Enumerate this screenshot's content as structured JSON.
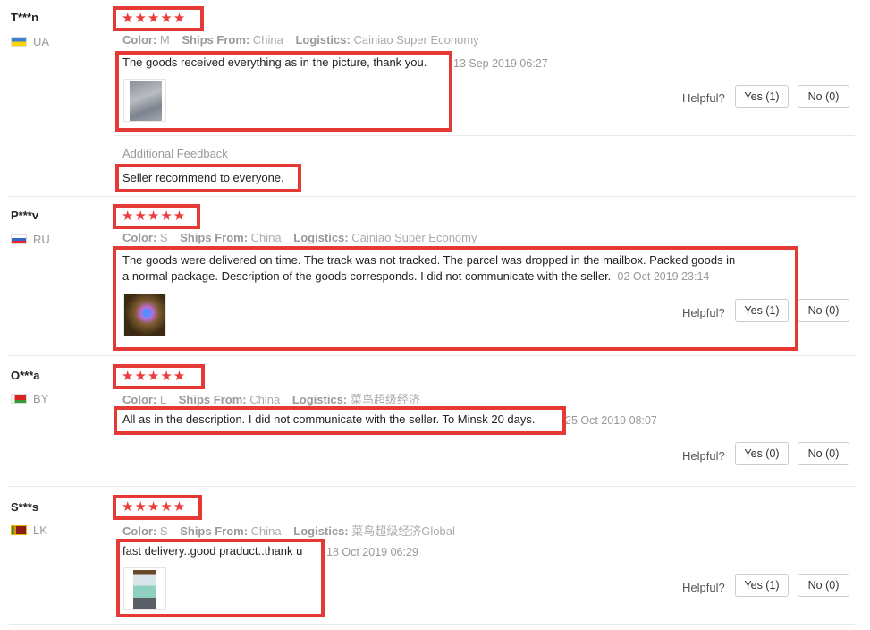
{
  "helpful_label": "Helpful?",
  "reviews": [
    {
      "user": "T***n",
      "country": "UA",
      "stars": "★★★★★",
      "color_label": "Color:",
      "color": "M",
      "ships_label": "Ships From:",
      "ships": "China",
      "logistics_label": "Logistics:",
      "logistics": "Cainiao Super Economy",
      "text": "The goods received everything as in the picture, thank you.",
      "date": "13 Sep 2019 06:27",
      "yes": "Yes (1)",
      "no": "No (0)",
      "additional_label": "Additional Feedback",
      "additional_text": "Seller recommend to everyone."
    },
    {
      "user": "P***v",
      "country": "RU",
      "stars": "★★★★★",
      "color_label": "Color:",
      "color": "S",
      "ships_label": "Ships From:",
      "ships": "China",
      "logistics_label": "Logistics:",
      "logistics": "Cainiao Super Economy",
      "text_line1": "The goods were delivered on time. The track was not tracked. The parcel was dropped in the mailbox. Packed goods in",
      "text_line2": "a normal package. Description of the goods corresponds. I did not communicate with the seller.",
      "date": "02 Oct 2019 23:14",
      "yes": "Yes (1)",
      "no": "No (0)"
    },
    {
      "user": "O***a",
      "country": "BY",
      "stars": "★★★★★",
      "color_label": "Color:",
      "color": "L",
      "ships_label": "Ships From:",
      "ships": "China",
      "logistics_label": "Logistics:",
      "logistics": "菜鸟超级经济",
      "text": "All as in the description. I did not communicate with the seller. To Minsk 20 days.",
      "date": "25 Oct 2019 08:07",
      "yes": "Yes (0)",
      "no": "No (0)"
    },
    {
      "user": "S***s",
      "country": "LK",
      "stars": "★★★★★",
      "color_label": "Color:",
      "color": "S",
      "ships_label": "Ships From:",
      "ships": "China",
      "logistics_label": "Logistics:",
      "logistics": "菜鸟超级经济Global",
      "text": "fast delivery..good praduct..thank u",
      "date": "18 Oct 2019 06:29",
      "yes": "Yes (1)",
      "no": "No (0)"
    }
  ]
}
